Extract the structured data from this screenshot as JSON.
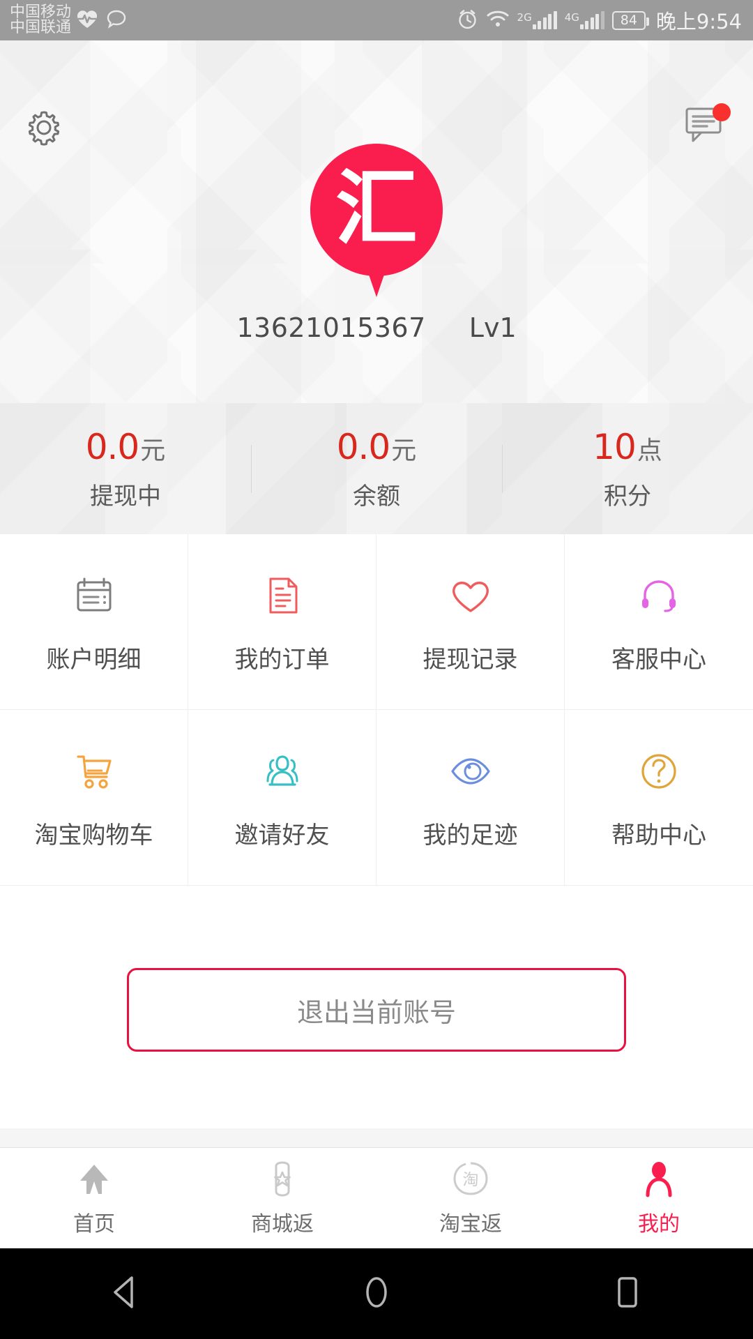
{
  "statusbar": {
    "carrier1": "中国移动",
    "carrier2": "中国联通",
    "heart_icon": "heart-pulse-icon",
    "chat_icon": "chat-bubble-icon",
    "alarm_icon": "alarm-clock-icon",
    "wifi_icon": "wifi-icon",
    "net1_label": "2G",
    "net2_label": "4G",
    "battery_level": "84",
    "time": "晚上9:54"
  },
  "header": {
    "settings_icon": "gear-icon",
    "message_icon": "message-icon",
    "has_message_badge": true
  },
  "profile": {
    "avatar_char": "汇",
    "avatar_color": "#fa1e4e",
    "phone": "13621015367",
    "level": "Lv1"
  },
  "stats": [
    {
      "number": "0.0",
      "unit": "元",
      "label": "提现中"
    },
    {
      "number": "0.0",
      "unit": "元",
      "label": "余额"
    },
    {
      "number": "10",
      "unit": "点",
      "label": "积分"
    }
  ],
  "grid": [
    {
      "label": "账户明细",
      "icon": "ledger-icon",
      "color": "#7d7d7d"
    },
    {
      "label": "我的订单",
      "icon": "document-icon",
      "color": "#f05b5b"
    },
    {
      "label": "提现记录",
      "icon": "heart-icon",
      "color": "#f05b5b"
    },
    {
      "label": "客服中心",
      "icon": "headset-icon",
      "color": "#e563e5"
    },
    {
      "label": "淘宝购物车",
      "icon": "shopping-cart-icon",
      "color": "#f5a33c"
    },
    {
      "label": "邀请好友",
      "icon": "people-group-icon",
      "color": "#36bfc4"
    },
    {
      "label": "我的足迹",
      "icon": "eye-icon",
      "color": "#6b8ede"
    },
    {
      "label": "帮助中心",
      "icon": "question-circle-icon",
      "color": "#e0a53a"
    }
  ],
  "logout": {
    "label": "退出当前账号",
    "border_color": "#e8113f"
  },
  "tabbar": {
    "active_color": "#fa1e4e",
    "items": [
      {
        "label": "首页",
        "icon": "home-arrow-icon",
        "active": false
      },
      {
        "label": "商城返",
        "icon": "tag-star-icon",
        "active": false
      },
      {
        "label": "淘宝返",
        "icon": "taobao-circle-icon",
        "active": false
      },
      {
        "label": "我的",
        "icon": "person-icon",
        "active": true
      }
    ]
  },
  "androidnav": {
    "back_icon": "back-triangle-icon",
    "home_icon": "home-circle-icon",
    "recents_icon": "recents-square-icon"
  }
}
